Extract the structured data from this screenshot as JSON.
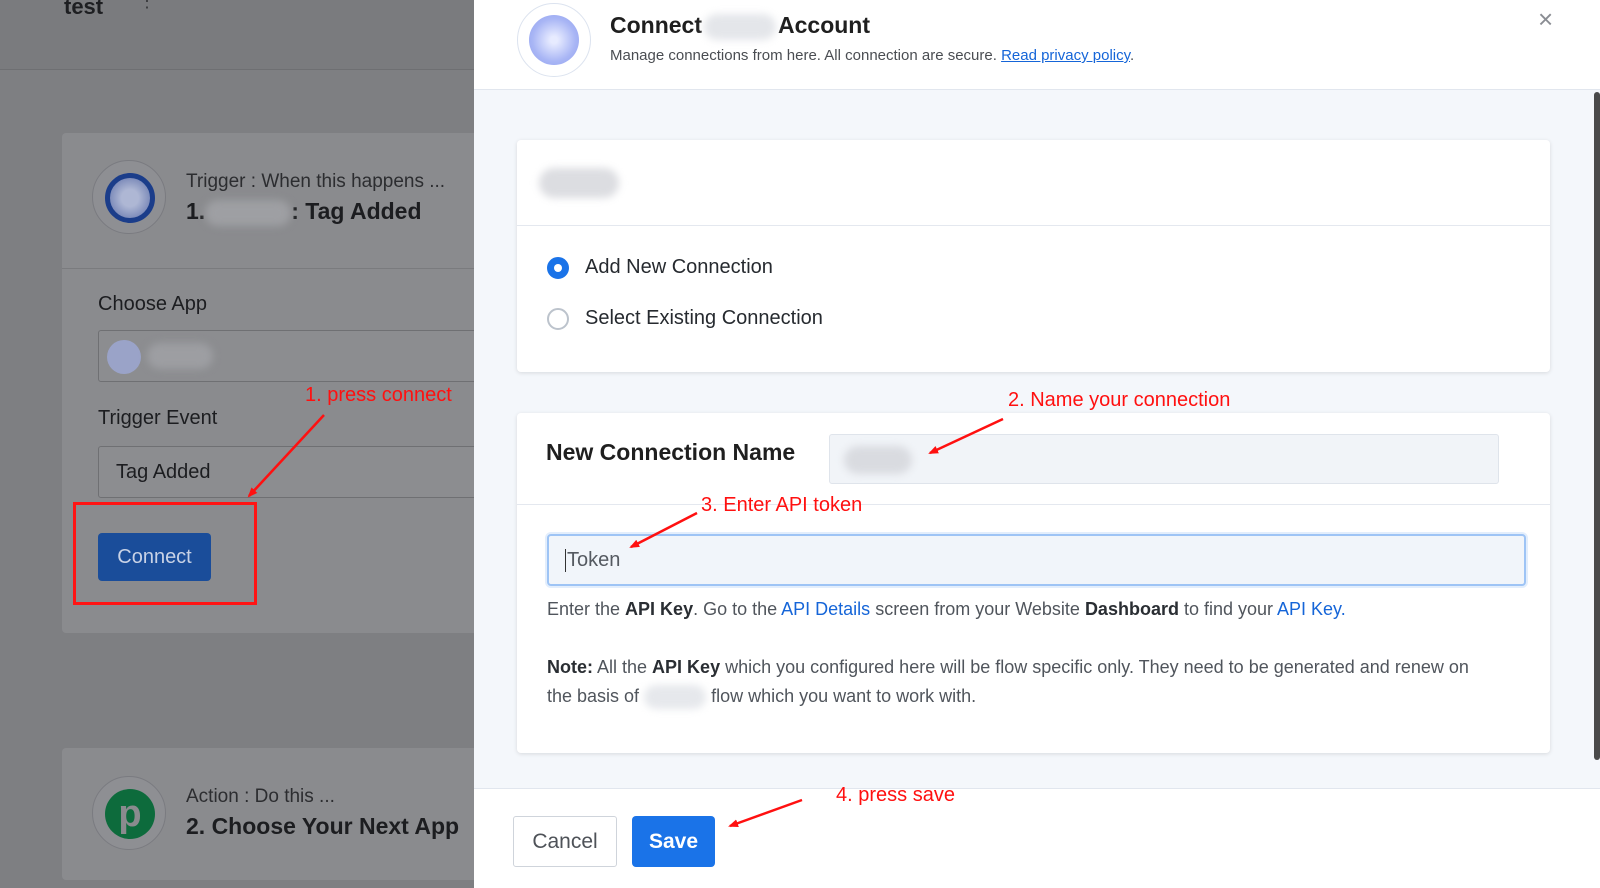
{
  "background": {
    "workflow_title": "test",
    "trigger": {
      "kicker": "Trigger : When this happens ...",
      "heading_prefix": "1.",
      "heading_suffix": ": Tag Added",
      "choose_app_label": "Choose App",
      "trigger_event_label": "Trigger Event",
      "trigger_event_value": "Tag Added",
      "connect_label": "Connect"
    },
    "action": {
      "kicker": "Action : Do this ...",
      "heading": "2. Choose Your Next App",
      "icon_glyph": "p"
    }
  },
  "modal": {
    "title_prefix": "Connect",
    "title_suffix": "Account",
    "subtitle": "Manage connections from here. All connection are secure.",
    "privacy_link": "Read privacy policy",
    "subtitle_end": ".",
    "close_icon": "×",
    "options": {
      "add_new": "Add New Connection",
      "select_existing": "Select Existing Connection",
      "selected": "add_new"
    },
    "form": {
      "connection_name_label": "New Connection Name",
      "token_placeholder": "Token",
      "help": {
        "p1": "Enter the ",
        "b1": "API Key",
        "p2": ". Go to the ",
        "link1": "API Details",
        "p3": " screen from your Website ",
        "b2": "Dashboard",
        "p4": " to find your ",
        "link2": "API Key."
      },
      "note": {
        "label": "Note:",
        "p1": " All the ",
        "b1": "API Key",
        "p2": " which you configured here will be flow specific only. They need to be generated and renew on the basis of ",
        "p3": " flow which you want to work with."
      }
    },
    "footer": {
      "cancel_label": "Cancel",
      "save_label": "Save"
    }
  },
  "annotations": {
    "step1": "1. press connect",
    "step2": "2. Name your connection",
    "step3": "3. Enter API token",
    "step4": "4. press save"
  },
  "colors": {
    "primary": "#1a73e8",
    "annotation": "#ff1010",
    "overlay": "#7e7f82"
  }
}
